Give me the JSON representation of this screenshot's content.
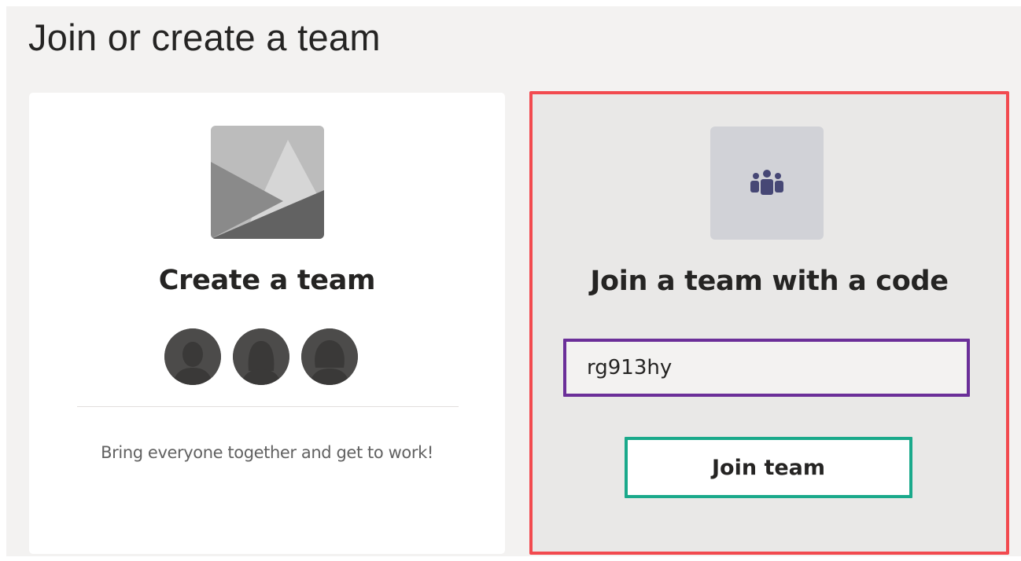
{
  "page": {
    "title": "Join or create a team"
  },
  "create_card": {
    "image_icon": "landscape-placeholder-icon",
    "title": "Create a team",
    "avatars": [
      "person-avatar-icon",
      "person-avatar-icon",
      "person-avatar-icon"
    ],
    "description": "Bring everyone together and get to work!"
  },
  "join_card": {
    "image_icon": "team-people-icon",
    "title": "Join a team with a code",
    "code_input": {
      "value": "rg913hy"
    },
    "button_label": "Join team"
  },
  "colors": {
    "background": "#f3f2f1",
    "join_card_highlight": "#f24a4f",
    "input_highlight": "#6b2f99",
    "button_highlight": "#1aa98b"
  }
}
